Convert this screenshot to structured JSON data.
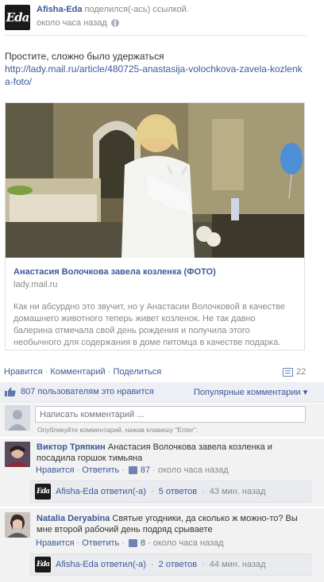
{
  "post": {
    "author": "Afisha-Eda",
    "action": "поделился(-ась) ссылкой.",
    "time": "около часа назад",
    "logo_text": "Eda",
    "message": "Простите, сложно было удержаться",
    "url": "http://lady.mail.ru/article/480725-anastasija-volochkova-zavela-kozlenka-foto/"
  },
  "attachment": {
    "title": "Анастасия Волочкова завела козленка (ФОТО)",
    "domain": "lady.mail.ru",
    "description": "Как ни абсурдно это звучит, но у Анастасии Волочковой в качестве домашнего животного теперь живет козленок. Не так давно балерина отмечала свой день рождения и получила этого необычного для содержания в доме питомца в качестве подарка."
  },
  "actions": {
    "like": "Нравится",
    "comment": "Комментарий",
    "share": "Поделиться",
    "comment_count": "22",
    "sep": "·"
  },
  "likes": {
    "count": "807",
    "text": "пользователям это нравится",
    "sort": "Популярные комментарии ▾"
  },
  "comment_box": {
    "placeholder": "Написать комментарий ...",
    "hint": "Опубликуйте комментарий, нажав клавишу \"Enter\"."
  },
  "comments": [
    {
      "author": "Виктор Тряпкин",
      "text": "Анастасия Волочкова завела козленка и посадила горшок тимьяна",
      "like": "Нравится",
      "reply": "Ответить",
      "likes": "87",
      "time": "около часа назад",
      "reply_author": "Afisha-Eda ответил(-а)",
      "reply_count": "5 ответов",
      "reply_time": "43 мин. назад"
    },
    {
      "author": "Natalia Deryabina",
      "text": "Святые угодники, да сколько ж можно-то? Вы мне второй рабочий день подряд срываете",
      "like": "Нравится",
      "reply": "Ответить",
      "likes": "8",
      "time": "около часа назад",
      "reply_author": "Afisha-Eda ответил(-а)",
      "reply_count": "2 ответов",
      "reply_time": "44 мин. назад"
    }
  ],
  "colors": {
    "link": "#3b5998",
    "muted": "#888888",
    "panel": "#f2f2f2",
    "like_bar": "#edeff4"
  }
}
